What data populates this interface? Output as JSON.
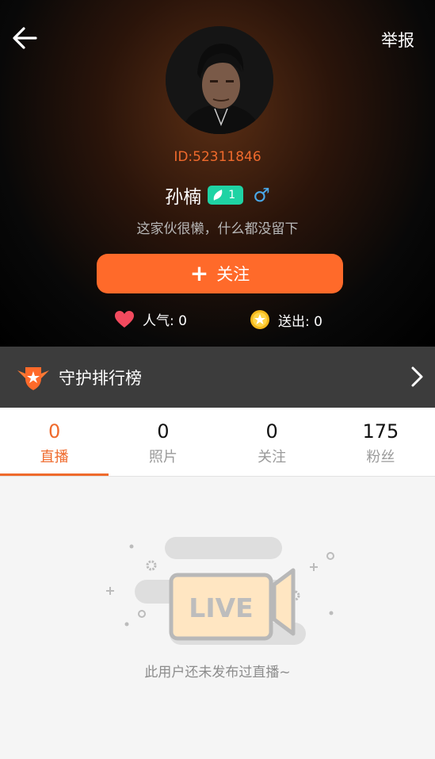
{
  "header": {
    "report_label": "举报",
    "user_id": "ID:52311846",
    "name": "孙楠",
    "level": "1",
    "gender_symbol": "♂",
    "bio": "这家伙很懒，什么都没留下",
    "follow_plus": "+",
    "follow_label": "关注",
    "popularity": "人气: 0",
    "sent": "送出: 0"
  },
  "guard": {
    "label": "守护排行榜"
  },
  "tabs": [
    {
      "count": "0",
      "label": "直播"
    },
    {
      "count": "0",
      "label": "照片"
    },
    {
      "count": "0",
      "label": "关注"
    },
    {
      "count": "175",
      "label": "粉丝"
    }
  ],
  "empty": {
    "live_text": "LIVE",
    "message": "此用户还未发布过直播~"
  },
  "colors": {
    "accent": "#ff6a2a",
    "id_text": "#ef6a2c",
    "level_badge": "#1fd3a4",
    "gender": "#4aa8e8",
    "guard_bar": "#3c3c3c"
  },
  "icons": [
    "back-arrow-icon",
    "leaf-icon",
    "male-icon",
    "plus-icon",
    "heart-icon",
    "coin-star-icon",
    "shield-star-icon",
    "chevron-right-icon",
    "live-camera-icon"
  ]
}
